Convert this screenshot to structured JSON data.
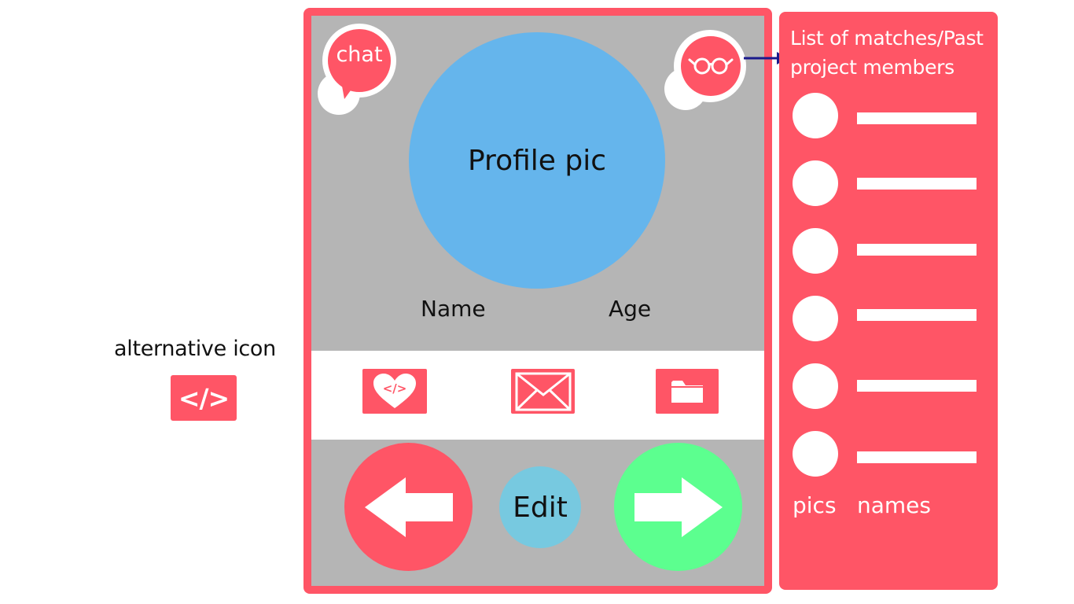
{
  "alternative": {
    "label": "alternative icon",
    "icon_text": "</>"
  },
  "profile": {
    "chat_label": "chat",
    "pic_label": "Profile pic",
    "name_label": "Name",
    "age_label": "Age",
    "glasses_icon": "glasses-icon"
  },
  "actions": {
    "icons": [
      "heart-code-icon",
      "envelope-icon",
      "folder-icon"
    ],
    "heart_code_text": "</>"
  },
  "nav": {
    "back_icon": "arrow-left-icon",
    "edit_label": "Edit",
    "next_icon": "arrow-right-icon"
  },
  "sidebar": {
    "title": "List of matches/Past project members",
    "pics_label": "pics",
    "names_label": "names",
    "item_count_shown": 6
  },
  "colors": {
    "accent": "#ff5566",
    "panel_gray": "#b5b5b5",
    "profile_blue": "#65b5ec",
    "edit_blue": "#77c9e0",
    "next_green": "#5cff8f",
    "arrow_navy": "#1a1a8c"
  }
}
